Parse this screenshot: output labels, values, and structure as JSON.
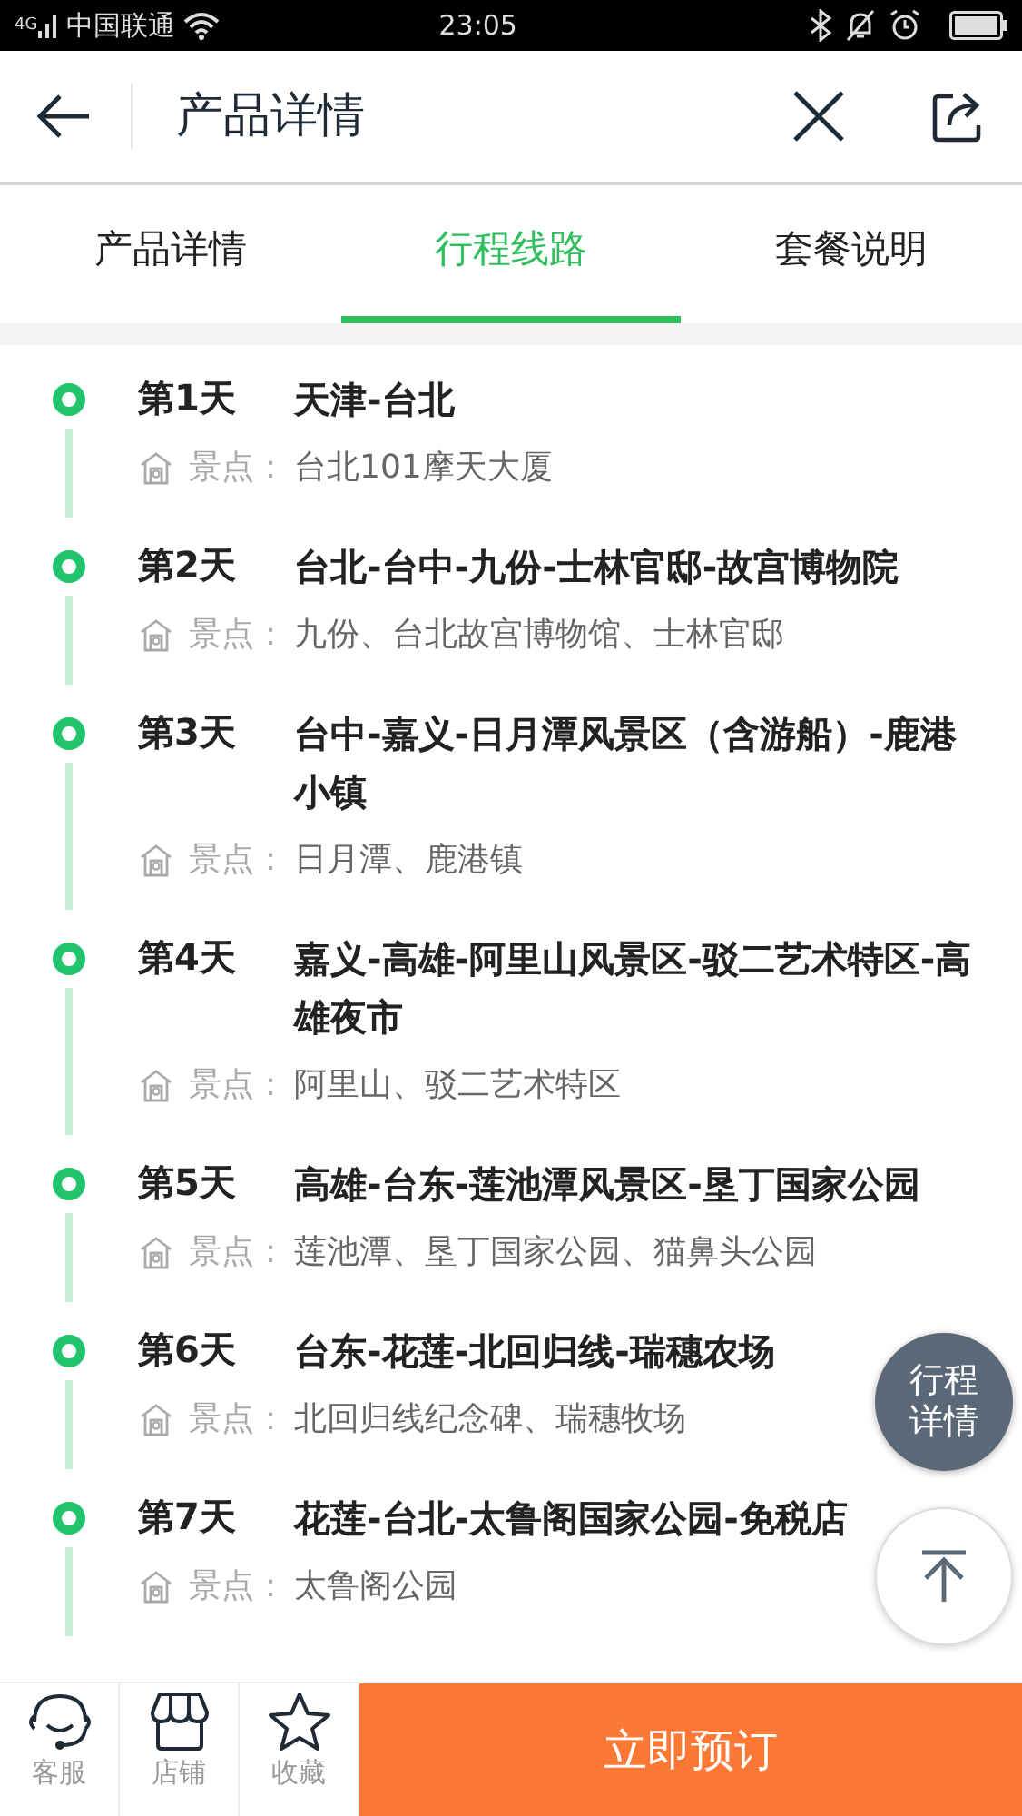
{
  "status_bar": {
    "network": "4G",
    "carrier": "中国联通",
    "time": "23:05"
  },
  "header": {
    "title": "产品详情"
  },
  "tabs": [
    {
      "label": "产品详情",
      "selected": false
    },
    {
      "label": "行程线路",
      "selected": true
    },
    {
      "label": "套餐说明",
      "selected": false
    }
  ],
  "days": [
    {
      "day": "第1天",
      "route": "天津-台北",
      "spots_label": "景点：",
      "spots": "台北101摩天大厦"
    },
    {
      "day": "第2天",
      "route": "台北-台中-九份-士林官邸-故宫博物院",
      "spots_label": "景点：",
      "spots": "九份、台北故宫博物馆、士林官邸"
    },
    {
      "day": "第3天",
      "route": "台中-嘉义-日月潭风景区（含游船）-鹿港小镇",
      "spots_label": "景点：",
      "spots": "日月潭、鹿港镇"
    },
    {
      "day": "第4天",
      "route": "嘉义-高雄-阿里山风景区-驳二艺术特区-高雄夜市",
      "spots_label": "景点：",
      "spots": "阿里山、驳二艺术特区"
    },
    {
      "day": "第5天",
      "route": "高雄-台东-莲池潭风景区-垦丁国家公园",
      "spots_label": "景点：",
      "spots": "莲池潭、垦丁国家公园、猫鼻头公园"
    },
    {
      "day": "第6天",
      "route": "台东-花莲-北回归线-瑞穗农场",
      "spots_label": "景点：",
      "spots": "北回归线纪念碑、瑞穗牧场"
    },
    {
      "day": "第7天",
      "route": "花莲-台北-太鲁阁国家公园-免税店",
      "spots_label": "景点：",
      "spots": "太鲁阁公园"
    }
  ],
  "floating": {
    "itinerary_button": "行程详情"
  },
  "bottom_bar": {
    "items": [
      {
        "kind": "service",
        "label": "客服"
      },
      {
        "kind": "shop",
        "label": "店铺"
      },
      {
        "kind": "favorite",
        "label": "收藏"
      }
    ],
    "book_button": "立即预订"
  }
}
